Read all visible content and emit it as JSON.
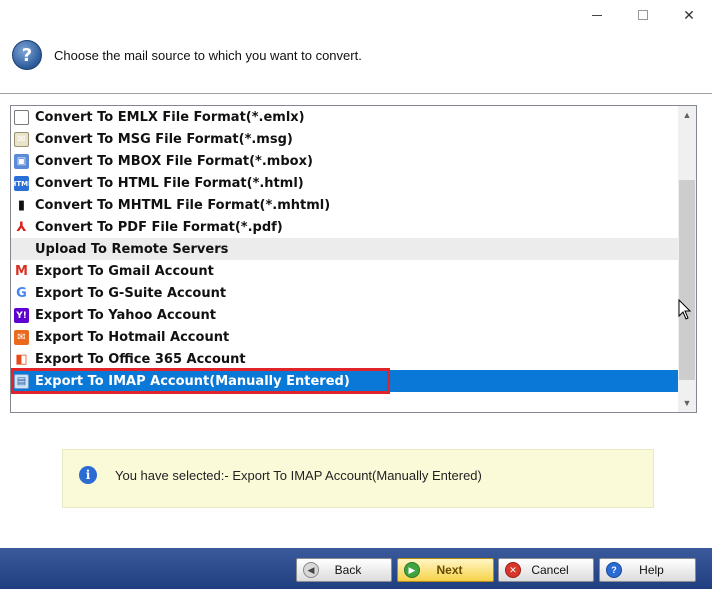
{
  "window": {
    "controls": {
      "minimize": "—",
      "maximize": "",
      "close": "✕"
    }
  },
  "header": {
    "prompt": "Choose the mail source to which you want to convert."
  },
  "list": {
    "items": [
      {
        "label": "Convert To EMLX File Format(*.emlx)",
        "icon": "envelope-icon",
        "glyph": "✉",
        "type": "option"
      },
      {
        "label": "Convert To MSG File Format(*.msg)",
        "icon": "msg-file-icon",
        "glyph": "✉",
        "type": "option"
      },
      {
        "label": "Convert To MBOX File Format(*.mbox)",
        "icon": "mbox-icon",
        "glyph": "▣",
        "type": "option"
      },
      {
        "label": "Convert To HTML File Format(*.html)",
        "icon": "html-icon",
        "glyph": "HTML",
        "type": "option"
      },
      {
        "label": "Convert To MHTML File Format(*.mhtml)",
        "icon": "mhtml-icon",
        "glyph": "▮",
        "type": "option"
      },
      {
        "label": "Convert To PDF File Format(*.pdf)",
        "icon": "pdf-icon",
        "glyph": "⅄",
        "type": "option"
      },
      {
        "label": "Upload To Remote Servers",
        "icon": "",
        "glyph": "",
        "type": "group"
      },
      {
        "label": "Export To Gmail Account",
        "icon": "gmail-icon",
        "glyph": "M",
        "type": "option"
      },
      {
        "label": "Export To G-Suite Account",
        "icon": "google-icon",
        "glyph": "G",
        "type": "option"
      },
      {
        "label": "Export To Yahoo Account",
        "icon": "yahoo-icon",
        "glyph": "Y!",
        "type": "option"
      },
      {
        "label": "Export To Hotmail Account",
        "icon": "hotmail-icon",
        "glyph": "✉",
        "type": "option"
      },
      {
        "label": "Export To Office 365 Account",
        "icon": "office365-icon",
        "glyph": "◧",
        "type": "option"
      },
      {
        "label": "Export To IMAP Account(Manually Entered)",
        "icon": "imap-icon",
        "glyph": "▤",
        "type": "selected"
      }
    ]
  },
  "info": {
    "text": "You have selected:- Export To IMAP Account(Manually Entered)"
  },
  "buttons": {
    "back": "Back",
    "next": "Next",
    "cancel": "Cancel",
    "help": "Help"
  },
  "colors": {
    "selection": "#0a78d7",
    "highlight_outline": "#e0242a",
    "info_background": "#fafad9",
    "bottom_bar": "#2a4a8c"
  }
}
